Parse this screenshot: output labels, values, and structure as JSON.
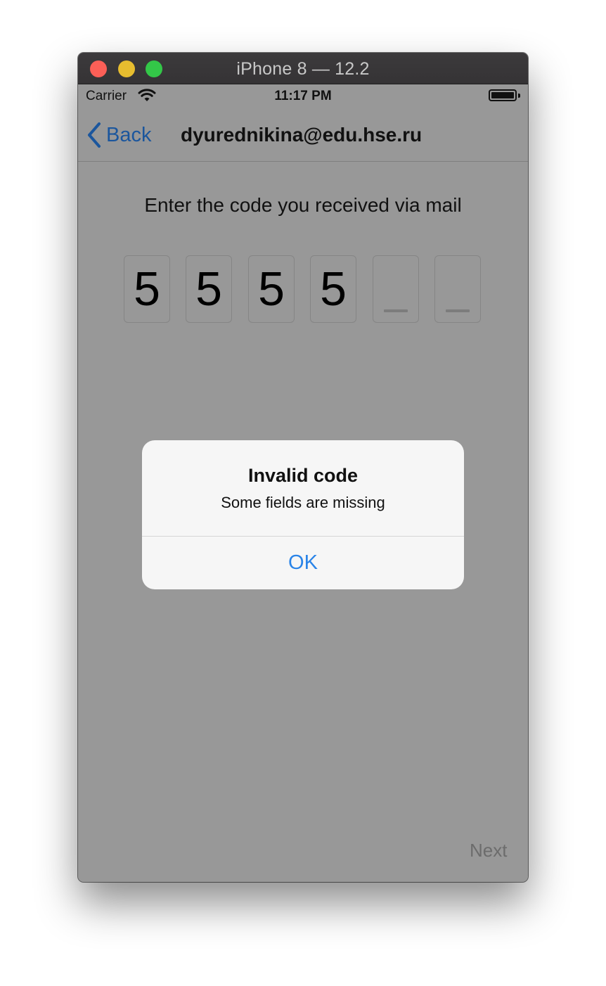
{
  "window": {
    "title": "iPhone 8 — 12.2"
  },
  "status_bar": {
    "carrier": "Carrier",
    "time": "11:17 PM"
  },
  "nav": {
    "back_label": "Back",
    "title": "dyurednikina@edu.hse.ru"
  },
  "content": {
    "prompt": "Enter the code you received via mail",
    "code_digits": [
      "5",
      "5",
      "5",
      "5",
      "",
      ""
    ],
    "next_label": "Next"
  },
  "alert": {
    "title": "Invalid code",
    "message": "Some fields are missing",
    "ok_label": "OK"
  },
  "colors": {
    "link_blue": "#2a84e8",
    "nav_back_blue": "#1b569d",
    "dimmed_background": "#989898"
  }
}
